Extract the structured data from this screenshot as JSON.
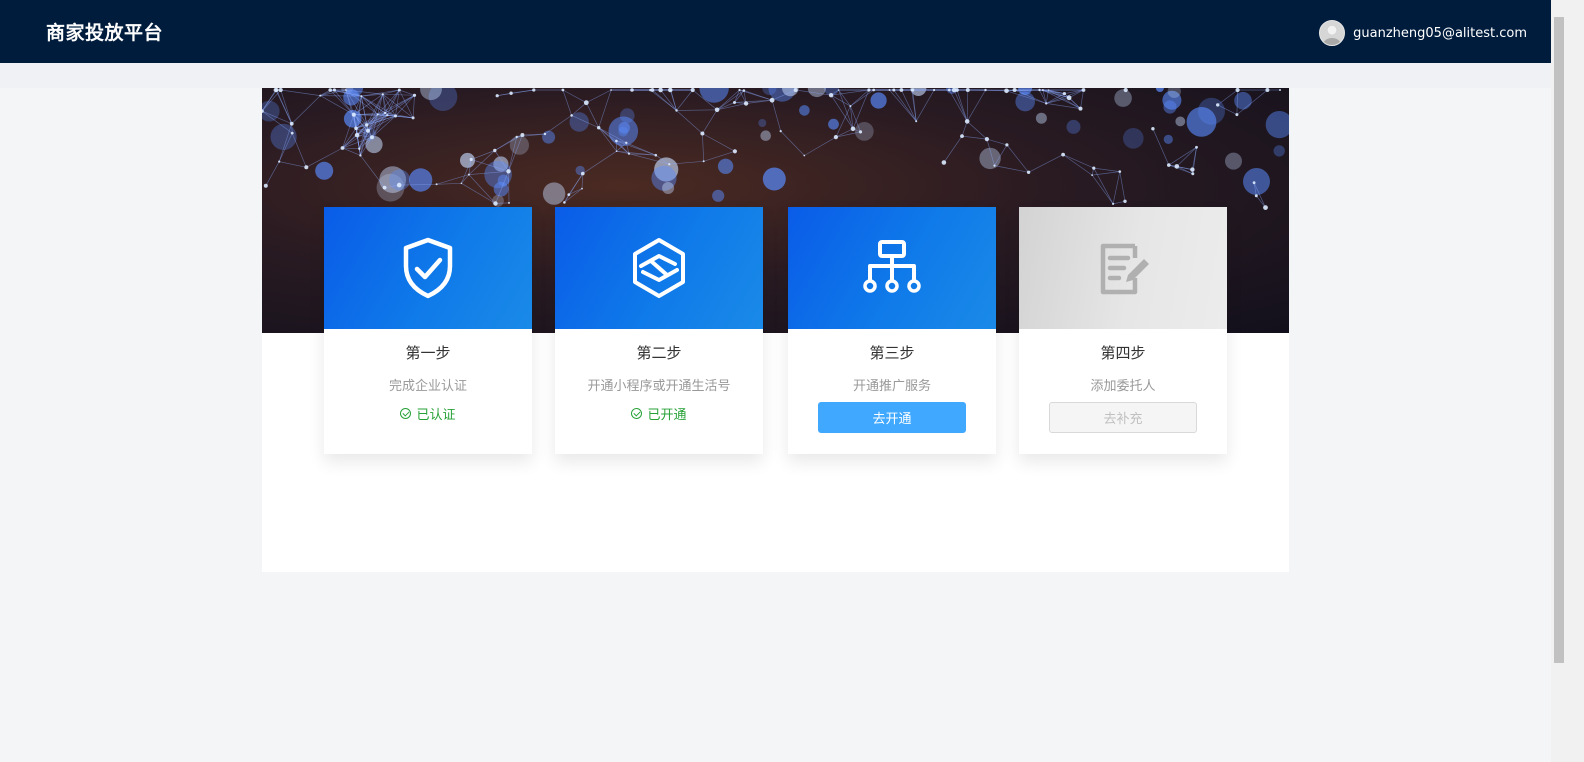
{
  "header": {
    "brand": "商家投放平台",
    "user_email": "guanzheng05@alitest.com"
  },
  "steps": [
    {
      "title": "第一步",
      "desc": "完成企业认证",
      "status": "已认证",
      "icon": "shield-check-icon"
    },
    {
      "title": "第二步",
      "desc": "开通小程序或开通生活号",
      "status": "已开通",
      "icon": "hexagon-layers-icon"
    },
    {
      "title": "第三步",
      "desc": "开通推广服务",
      "button": "去开通",
      "icon": "hierarchy-icon"
    },
    {
      "title": "第四步",
      "desc": "添加委托人",
      "button": "去补充",
      "icon": "edit-document-icon"
    }
  ],
  "colors": {
    "topbar": "#001c3d",
    "card_blue": "#0f7ae9",
    "success": "#27a137",
    "primary_button": "#40a9ff"
  }
}
